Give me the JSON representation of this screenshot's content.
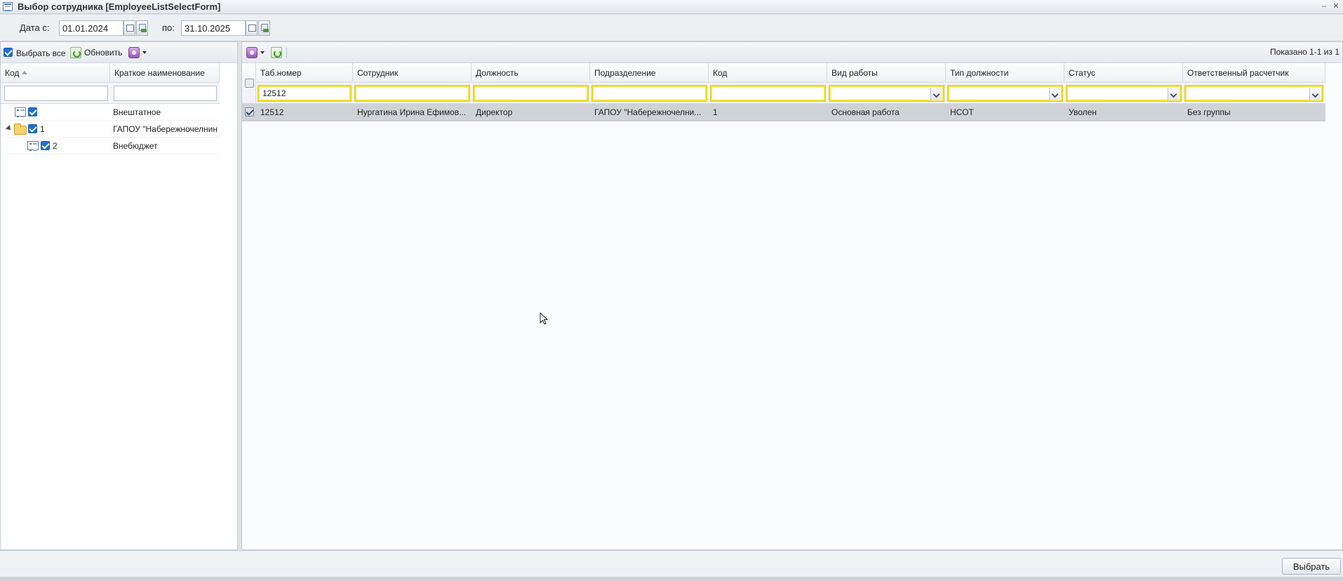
{
  "window": {
    "title": "Выбор сотрудника [EmployeeListSelectForm]",
    "minimize_glyph": "‒",
    "close_glyph": "✕"
  },
  "date_filter": {
    "from_label": "Дата с:",
    "from_value": "01.01.2024",
    "to_label": "по:",
    "to_value": "31.10.2025"
  },
  "left_panel": {
    "select_all_label": "Выбрать все",
    "select_all_checked": true,
    "refresh_label": "Обновить",
    "columns": [
      "Код",
      "Краткое наименование"
    ],
    "filters": [
      "",
      ""
    ],
    "rows": [
      {
        "code": "",
        "name": "Внештатное",
        "icon": "list-icon",
        "checked": true,
        "expanded": false
      },
      {
        "code": "1",
        "name": "ГАПОУ \"Набережночелнин",
        "icon": "folder-icon",
        "checked": true,
        "expanded": true
      },
      {
        "code": "2",
        "name": "Внебюджет",
        "icon": "list-icon",
        "checked": true,
        "expanded": false
      }
    ]
  },
  "right_panel": {
    "paging_text": "Показано 1-1 из 1",
    "columns": [
      "Таб.номер",
      "Сотрудник",
      "Должность",
      "Подразделение",
      "Код",
      "Вид работы",
      "Тип должности",
      "Статус",
      "Ответственный расчетчик"
    ],
    "filters": {
      "tab_number": "12512",
      "employee": "",
      "position": "",
      "department": "",
      "code": "",
      "work_type": "",
      "position_type": "",
      "status": "",
      "responsible": ""
    },
    "rows": [
      {
        "checked": true,
        "tab_number": "12512",
        "employee": "Нургатина Ирина Ефимов...",
        "position": "Директор",
        "department": "ГАПОУ \"Набережночелни...",
        "code": "1",
        "work_type": "Основная работа",
        "position_type": "НСОТ",
        "status": "Уволен",
        "responsible": "Без группы"
      }
    ]
  },
  "footer": {
    "select_button": "Выбрать"
  },
  "colors": {
    "accent_checkbox": "#1f6fd1",
    "filter_highlight": "#f2e33a",
    "selected_row": "#cfd3d8"
  }
}
